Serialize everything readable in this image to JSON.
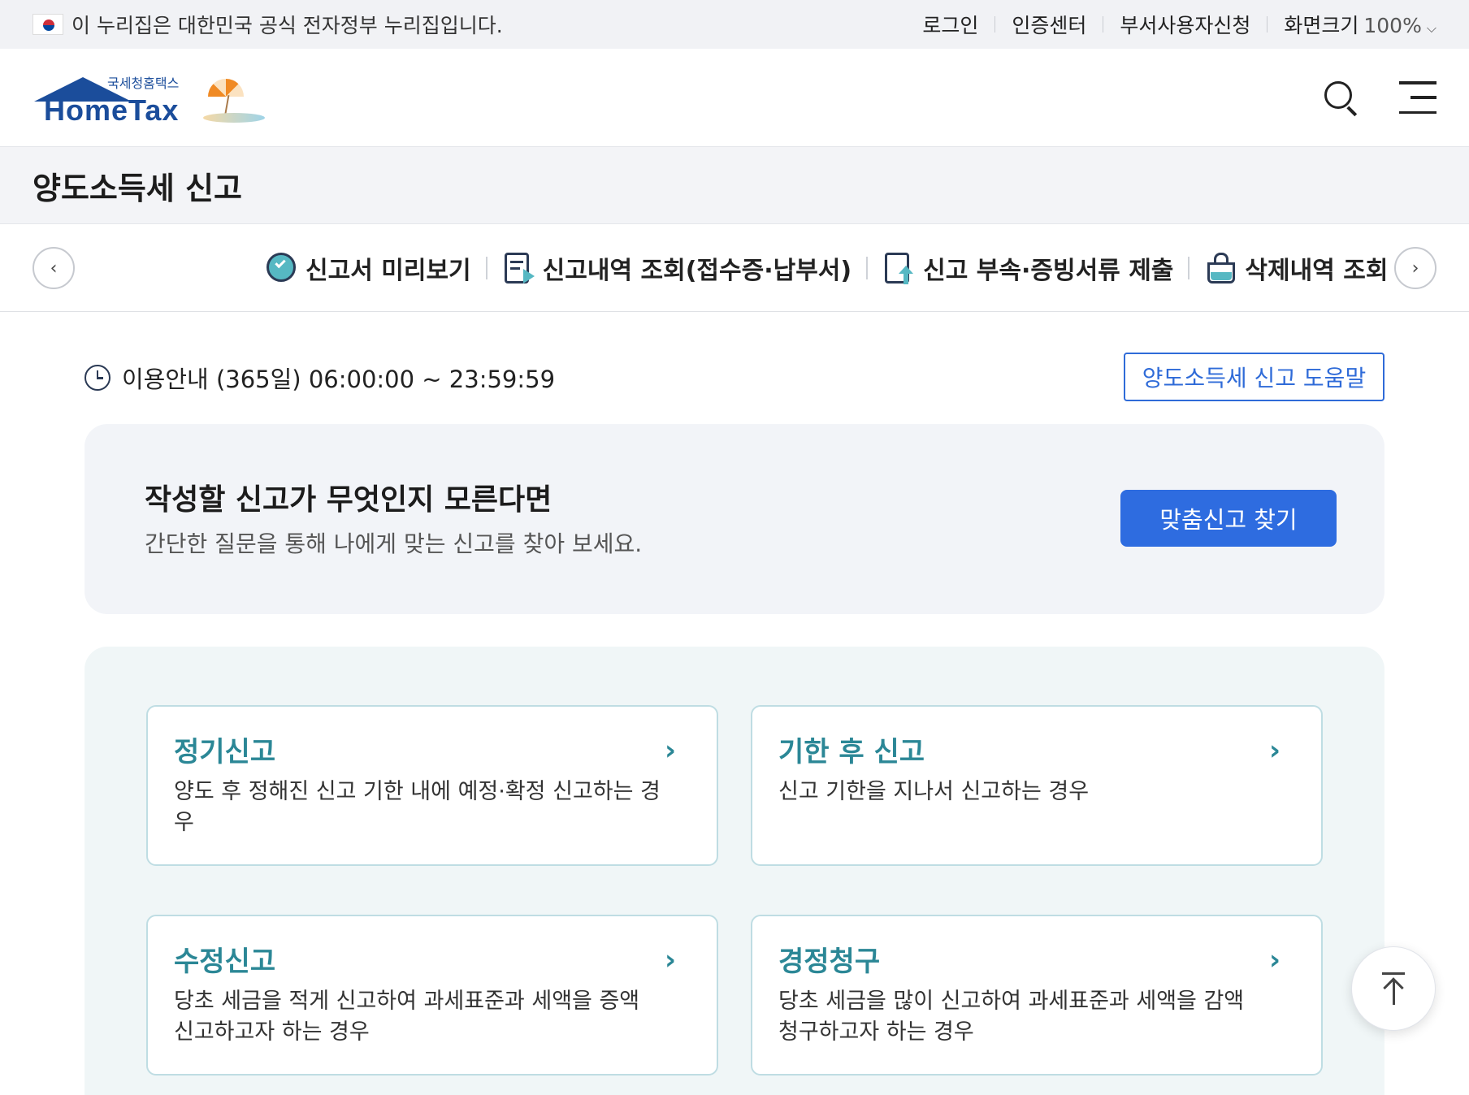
{
  "gov_banner": {
    "text": "이 누리집은 대한민국 공식 전자정부 누리집입니다.",
    "links": [
      {
        "label": "로그인"
      },
      {
        "label": "인증센터"
      },
      {
        "label": "부서사용자신청"
      }
    ],
    "zoom_label": "화면크기",
    "zoom_value": "100%"
  },
  "header": {
    "logo_sub": "국세청홈택스",
    "logo_main": "HomeTax",
    "icons": [
      "search-icon",
      "menu-icon"
    ]
  },
  "page": {
    "title": "양도소득세 신고"
  },
  "quick_menu": {
    "items": [
      {
        "label": "신고서 미리보기",
        "icon": "preview-check-icon"
      },
      {
        "label": "신고내역 조회(접수증·납부서)",
        "icon": "document-play-icon"
      },
      {
        "label": "신고 부속·증빙서류 제출",
        "icon": "document-upload-icon"
      },
      {
        "label": "삭제내역 조회",
        "icon": "trash-icon"
      }
    ]
  },
  "hours": {
    "text": "이용안내 (365일) 06:00:00 ~ 23:59:59"
  },
  "help_button": {
    "label": "양도소득세 신고 도움말"
  },
  "finder": {
    "title": "작성할 신고가 무엇인지 모른다면",
    "desc": "간단한 질문을 통해 나에게 맞는 신고를 찾아 보세요.",
    "button": "맞춤신고 찾기"
  },
  "cards": [
    {
      "title": "정기신고",
      "desc": "양도 후 정해진 신고 기한 내에 예정·확정 신고하는 경우"
    },
    {
      "title": "기한 후 신고",
      "desc": "신고 기한을 지나서 신고하는 경우"
    },
    {
      "title": "수정신고",
      "desc": "당초 세금을 적게 신고하여 과세표준과 세액을 증액 신고하고자 하는 경우"
    },
    {
      "title": "경정청구",
      "desc": "당초 세금을 많이 신고하여 과세표준과 세액을 감액 청구하고자 하는 경우"
    }
  ],
  "colors": {
    "brand_blue": "#1b4d9b",
    "primary_button": "#2e6ce0",
    "teal_accent": "#2b8796"
  }
}
